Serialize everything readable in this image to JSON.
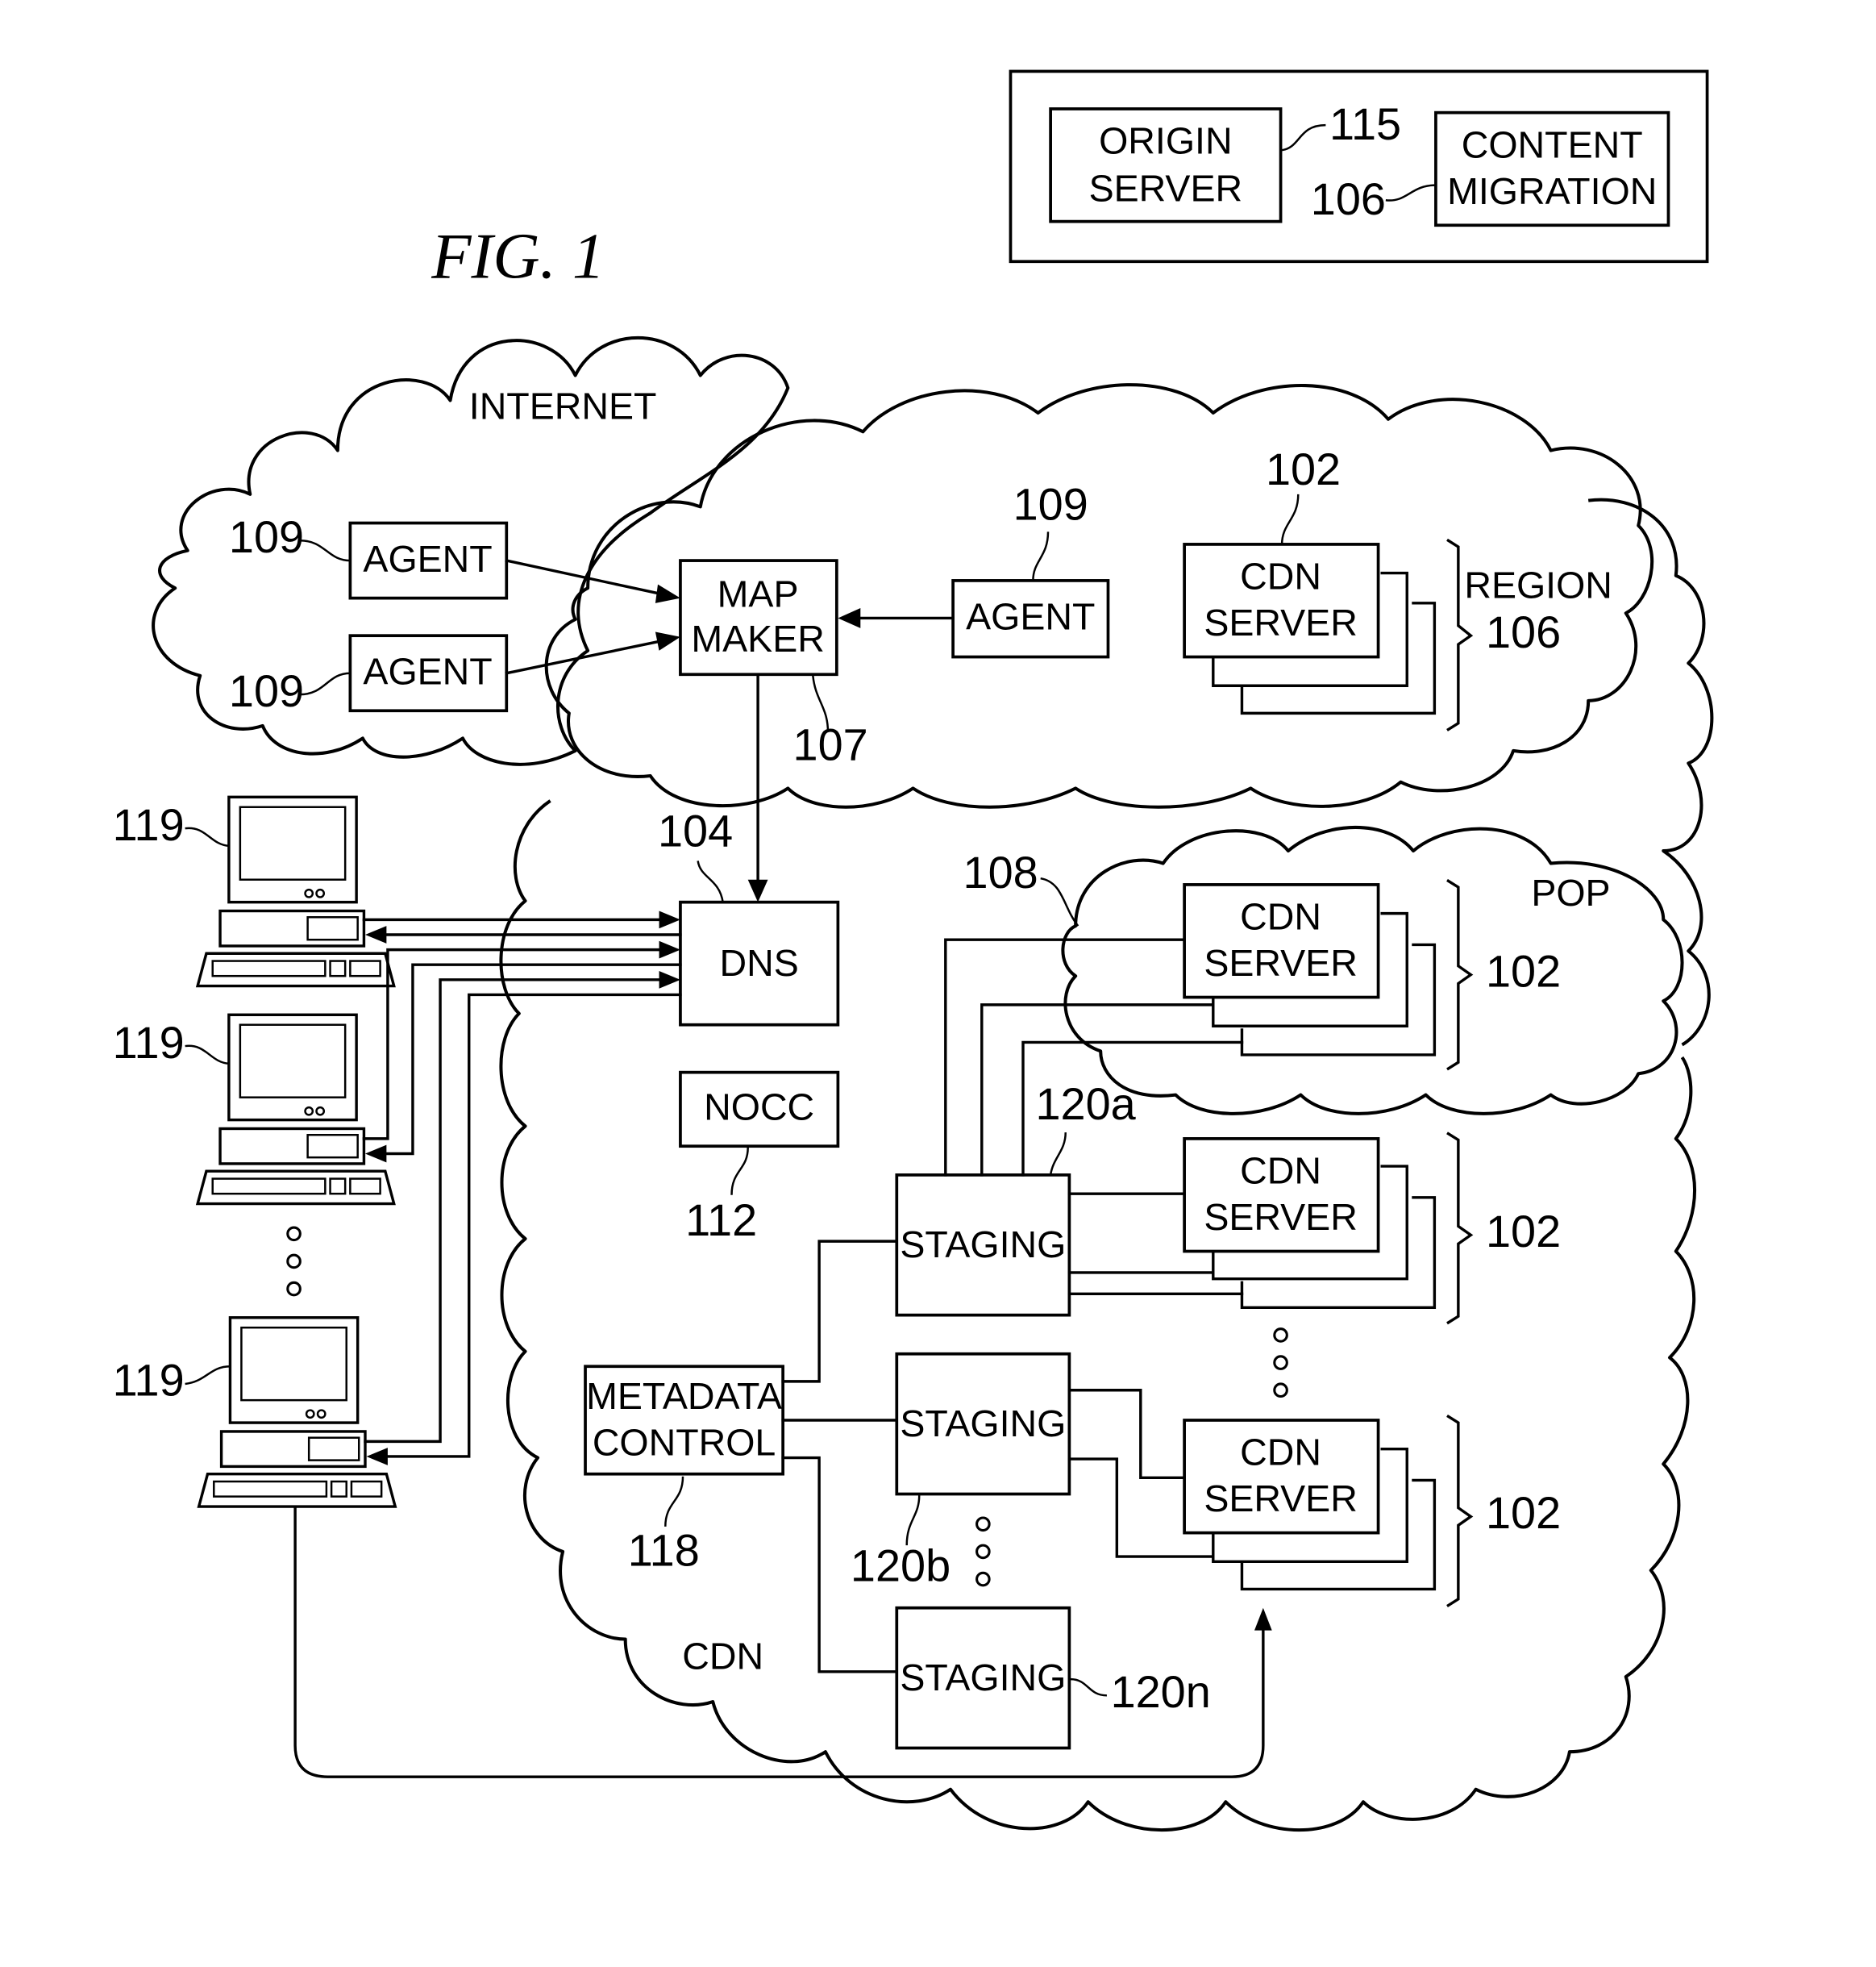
{
  "figure": {
    "title": "FIG.  1"
  },
  "legend_box": {
    "origin_server": {
      "line1": "ORIGIN",
      "line2": "SERVER",
      "ref": "115"
    },
    "content_migration": {
      "line1": "CONTENT",
      "line2": "MIGRATION",
      "ref": "106"
    }
  },
  "clouds": {
    "internet": {
      "label": "INTERNET"
    },
    "region": {
      "label": "REGION",
      "ref": "106"
    },
    "pop": {
      "label": "POP",
      "ref": "108"
    },
    "cdn": {
      "label": "CDN"
    }
  },
  "agents": [
    {
      "label": "AGENT",
      "ref": "109"
    },
    {
      "label": "AGENT",
      "ref": "109"
    },
    {
      "label": "AGENT",
      "ref": "109"
    }
  ],
  "map_maker": {
    "line1": "MAP",
    "line2": "MAKER",
    "ref": "107"
  },
  "dns": {
    "label": "DNS",
    "ref": "104"
  },
  "nocc": {
    "label": "NOCC",
    "ref": "112"
  },
  "metadata_control": {
    "line1": "METADATA",
    "line2": "CONTROL",
    "ref": "118"
  },
  "staging": [
    {
      "label": "STAGING",
      "ref": "120a"
    },
    {
      "label": "STAGING",
      "ref": "120b"
    },
    {
      "label": "STAGING",
      "ref": "120n"
    }
  ],
  "cdn_server_groups": [
    {
      "line1": "CDN",
      "line2": "SERVER",
      "ref": "102",
      "group_label": "REGION",
      "group_ref": "106"
    },
    {
      "line1": "CDN",
      "line2": "SERVER",
      "ref": "102"
    },
    {
      "line1": "CDN",
      "line2": "SERVER",
      "ref": "102"
    },
    {
      "line1": "CDN",
      "line2": "SERVER",
      "ref": "102"
    }
  ],
  "clients": [
    {
      "ref": "119",
      "icon": "computer-icon"
    },
    {
      "ref": "119",
      "icon": "computer-icon"
    },
    {
      "ref": "119",
      "icon": "computer-icon"
    }
  ],
  "ellipsis_icon": "vertical-ellipsis-icon"
}
